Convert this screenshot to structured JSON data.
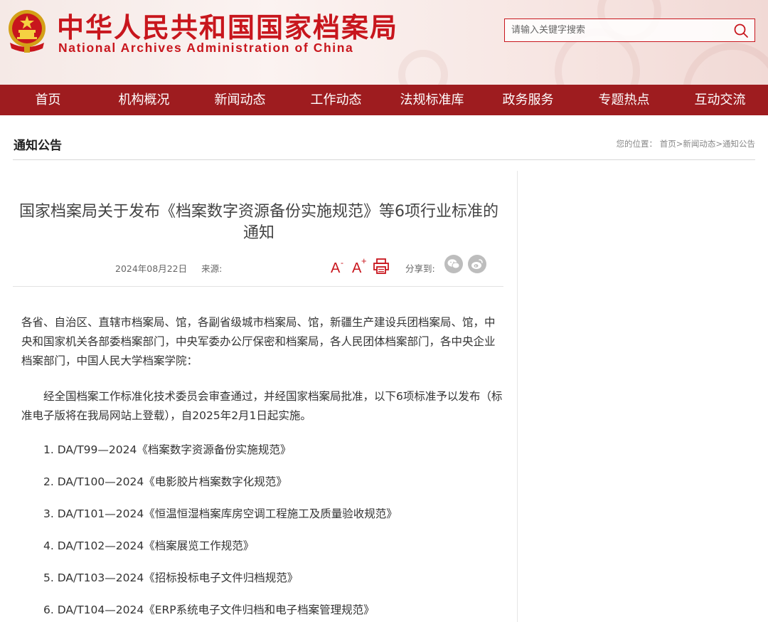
{
  "header": {
    "title_cn": "中华人民共和国国家档案局",
    "title_en": "National Archives Administration of China",
    "search_placeholder": "请输入关键字搜索",
    "brand_color": "#c8161d"
  },
  "nav": {
    "items": [
      "首页",
      "机构概况",
      "新闻动态",
      "工作动态",
      "法规标准库",
      "政务服务",
      "专题热点",
      "互动交流"
    ],
    "bg_color": "#9e1c1f"
  },
  "section": {
    "title": "通知公告",
    "breadcrumb": {
      "prefix": "您的位置：",
      "items": [
        "首页",
        "新闻动态",
        "通知公告"
      ],
      "separator": ">"
    }
  },
  "article": {
    "title": "国家档案局关于发布《档案数字资源备份实施规范》等6项行业标准的通知",
    "date": "2024年08月22日",
    "source_label": "来源:",
    "share_label": "分享到:",
    "tools": [
      "font-decrease-icon",
      "font-increase-icon",
      "print-icon"
    ],
    "share_icons": [
      "wechat-icon",
      "weibo-icon"
    ],
    "paragraphs": [
      "各省、自治区、直辖市档案局、馆，各副省级城市档案局、馆，新疆生产建设兵团档案局、馆，中央和国家机关各部委档案部门，中央军委办公厅保密和档案局，各人民团体档案部门，各中央企业档案部门，中国人民大学档案学院：",
      "经全国档案工作标准化技术委员会审查通过，并经国家档案局批准，以下6项标准予以发布（标准电子版将在我局网站上登载），自2025年2月1日起实施。"
    ],
    "standards": [
      "1.  DA/T99—2024《档案数字资源备份实施规范》",
      "2.  DA/T100—2024《电影胶片档案数字化规范》",
      "3.  DA/T101—2024《恒温恒湿档案库房空调工程施工及质量验收规范》",
      "4.  DA/T102—2024《档案展览工作规范》",
      "5.  DA/T103—2024《招标投标电子文件归档规范》",
      "6.  DA/T104—2024《ERP系统电子文件归档和电子档案管理规范》"
    ]
  }
}
